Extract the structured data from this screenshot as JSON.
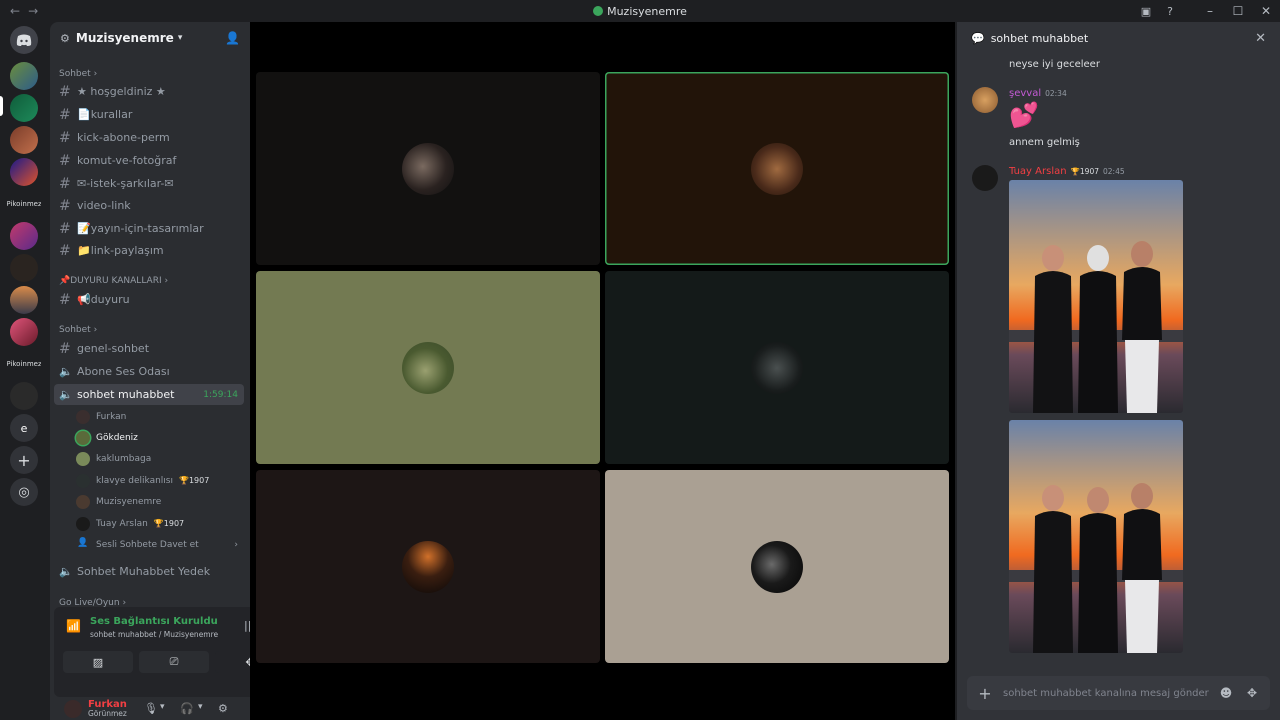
{
  "window": {
    "title": "Muzisyenemre",
    "back_icon": "←",
    "forward_icon": "→",
    "inbox_icon": "▣",
    "help_icon": "?",
    "min_icon": "–",
    "max_icon": "☐",
    "close_icon": "✕"
  },
  "rail": {
    "labels": [
      "Pikoinmez",
      "Pikoinmez",
      "e"
    ]
  },
  "server": {
    "name": "Muzisyenemre"
  },
  "categories": {
    "sohbet1": "Sohbet",
    "duyuru": "📌DUYURU KANALLARI",
    "sohbet2": "Sohbet",
    "golive": "Go Live/Oyun"
  },
  "channels": [
    "★ hoşgeldiniz ★",
    "📄kurallar",
    "kick-abone-perm",
    "komut-ve-fotoğraf",
    "✉-istek-şarkılar-✉",
    "video-link",
    "📝yayın-için-tasarımlar",
    "📁link-paylaşım",
    "📢duyuru",
    "genel-sohbet"
  ],
  "voice_channels": {
    "abone": "Abone Ses Odası",
    "muhabbet": "sohbet muhabbet",
    "muhabbet_timer": "1:59:14",
    "yedek": "Sohbet Muhabbet Yedek"
  },
  "voice_users": [
    {
      "name": "Furkan",
      "badge": ""
    },
    {
      "name": "Gökdeniz",
      "badge": ""
    },
    {
      "name": "kaklumbaga",
      "badge": ""
    },
    {
      "name": "klavye delikanlısı",
      "badge": "🏆1907"
    },
    {
      "name": "Muzisyenemre",
      "badge": ""
    },
    {
      "name": "Tuay Arslan",
      "badge": "🏆1907"
    },
    {
      "name": "Sesli Sohbete Davet et",
      "badge": ""
    }
  ],
  "voice_panel": {
    "status": "Ses Bağlantısı Kuruldu",
    "sub": "sohbet muhabbet / Muzisyenemre",
    "camera_icon": "▨",
    "screen_icon": "⎚",
    "activity_icon": "✥"
  },
  "user": {
    "name": "Furkan",
    "status": "Görünmez",
    "mic_icon": "🎙",
    "headset_icon": "🎧",
    "settings_icon": "⚙"
  },
  "chat": {
    "channel": "sohbet muhabbet",
    "messages": {
      "m0_text": "neyse iyi geceleer",
      "m1_name": "şevval",
      "m1_time": "02:34",
      "m1_emoji": "💕",
      "m1_text": "annem gelmiş",
      "m2_name": "Tuay Arslan",
      "m2_badge": "🏆1907",
      "m2_time": "02:45"
    },
    "placeholder": "sohbet muhabbet kanalına mesaj gönder"
  },
  "colors": {
    "accent_green": "#3ba55c",
    "name_red": "#f23f43",
    "name_purple": "#c45bd6"
  }
}
